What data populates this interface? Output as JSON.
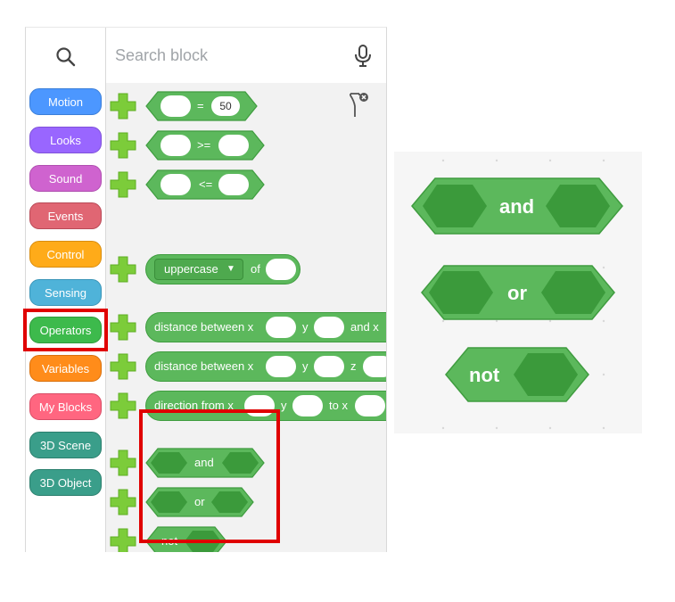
{
  "search": {
    "placeholder": "Search block"
  },
  "categories": [
    {
      "label": "Motion",
      "color": "#4c97ff"
    },
    {
      "label": "Looks",
      "color": "#9966ff"
    },
    {
      "label": "Sound",
      "color": "#cf63cf"
    },
    {
      "label": "Events",
      "color": "#e06673"
    },
    {
      "label": "Control",
      "color": "#ffab19"
    },
    {
      "label": "Sensing",
      "color": "#4fb3d9"
    },
    {
      "label": "Operators",
      "color": "#3dba4c"
    },
    {
      "label": "Variables",
      "color": "#ff8c1a"
    },
    {
      "label": "My Blocks",
      "color": "#ff6680"
    },
    {
      "label": "3D Scene",
      "color": "#3a9e8a"
    },
    {
      "label": "3D Object",
      "color": "#3a9e8a"
    }
  ],
  "selected_category": "Operators",
  "blocks": {
    "equals": {
      "op": "=",
      "value": "50"
    },
    "gte": {
      "op": ">="
    },
    "lte": {
      "op": "<="
    },
    "case": {
      "dropdown": "uppercase",
      "of": "of"
    },
    "distance_xy": {
      "a": "distance between x",
      "b": "y",
      "c": "and x"
    },
    "distance_xyz": {
      "a": "distance between x",
      "b": "y",
      "c": "z"
    },
    "direction": {
      "a": "direction from x",
      "b": "y",
      "c": "to x"
    },
    "and": "and",
    "or": "or",
    "not": "not"
  },
  "zoom": {
    "and": "and",
    "or": "or",
    "not": "not"
  },
  "colors": {
    "operator_green": "#5cb85c",
    "operator_dark": "#3b9a3b",
    "highlight": "#e00000",
    "plus_green": "#7ccc3a"
  }
}
